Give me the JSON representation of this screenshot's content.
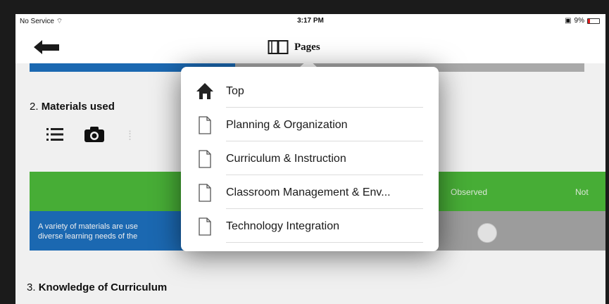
{
  "status_bar": {
    "carrier": "No Service",
    "time": "3:17 PM",
    "battery": "9%"
  },
  "nav": {
    "title": "Pages"
  },
  "progress": {
    "fraction": 0.37
  },
  "sections": [
    {
      "number": "2.",
      "title": "Materials used"
    },
    {
      "number": "3.",
      "title": "Knowledge of Curriculum"
    }
  ],
  "table": {
    "columns": [
      "Observed",
      "Not"
    ],
    "row_text_line1": "A variety of materials are use",
    "row_text_line2": "diverse learning needs of the"
  },
  "popover": {
    "items": [
      {
        "label": "Top",
        "icon": "home-icon"
      },
      {
        "label": "Planning & Organization",
        "icon": "page-icon"
      },
      {
        "label": "Curriculum & Instruction",
        "icon": "page-icon"
      },
      {
        "label": "Classroom Management & Env...",
        "icon": "page-icon"
      },
      {
        "label": "Technology Integration",
        "icon": "page-icon"
      }
    ]
  },
  "colors": {
    "accent_blue": "#1d6fbd",
    "accent_green": "#4cb83a",
    "gray": "#a6a6a6"
  }
}
